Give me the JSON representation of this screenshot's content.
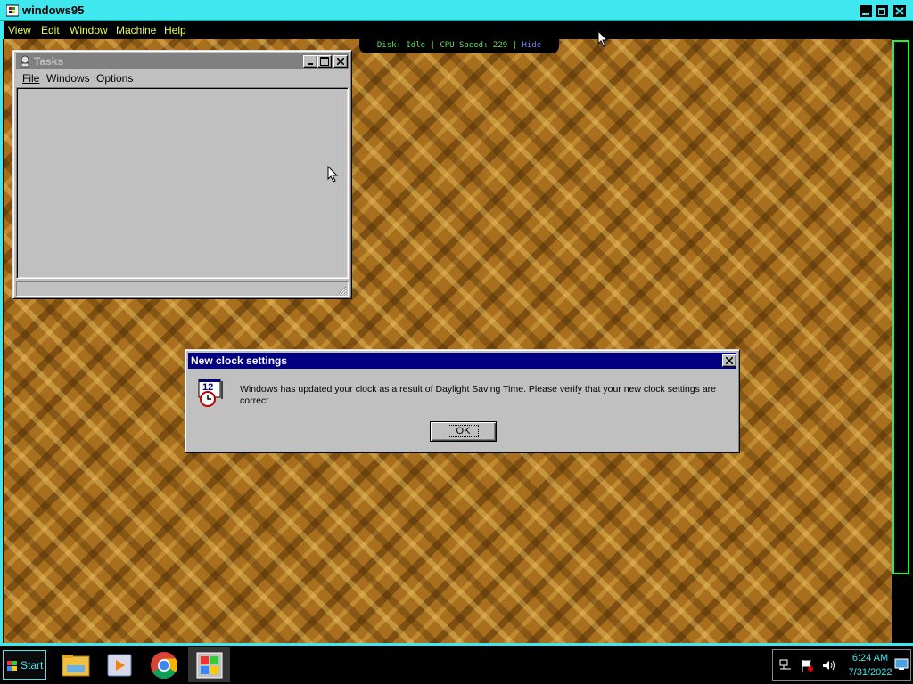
{
  "host": {
    "title": "windows95",
    "menu": [
      "View",
      "Edit",
      "Window",
      "Machine",
      "Help"
    ],
    "status": {
      "disk": "Disk: Idle",
      "cpu": "CPU Speed: 229",
      "hide": "Hide",
      "sep": "|"
    }
  },
  "tasks_window": {
    "title": "Tasks",
    "menu": [
      "File",
      "Windows",
      "Options"
    ]
  },
  "dialog": {
    "title": "New clock settings",
    "message": "Windows has updated your clock as a result of Daylight Saving Time.  Please verify that your new clock settings are correct.",
    "ok_label": "OK",
    "icon_text": "12"
  },
  "taskbar": {
    "start_label": "Start",
    "apps": [
      "file-explorer-icon",
      "media-player-icon",
      "chrome-icon",
      "windows95-app-icon"
    ],
    "time": "6:24 AM",
    "date": "7/31/2022"
  },
  "colors": {
    "host_accent": "#3fe8ee",
    "active_titlebar": "#000080",
    "inactive_titlebar": "#808080",
    "menu_text": "#e8ff50"
  }
}
